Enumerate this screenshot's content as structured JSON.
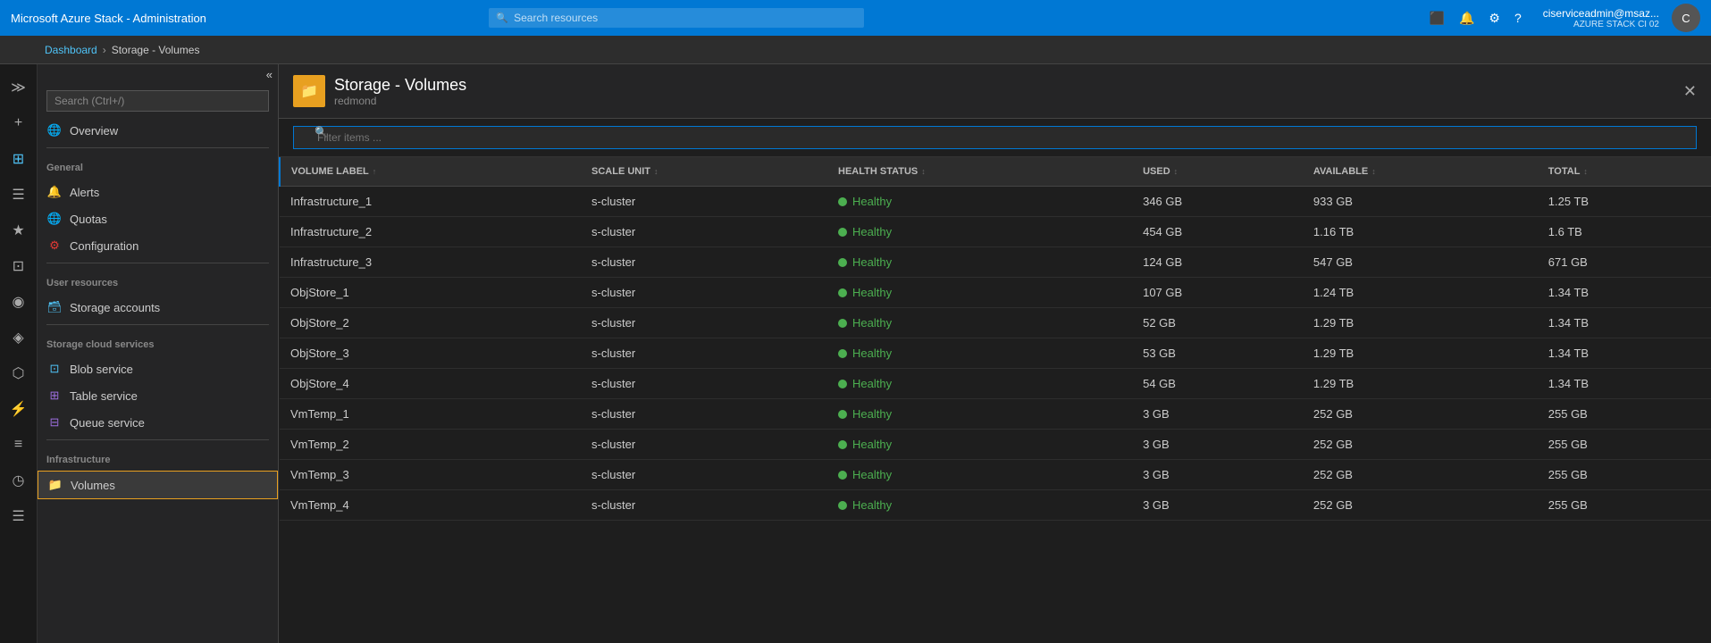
{
  "app": {
    "title": "Microsoft Azure Stack - Administration"
  },
  "topbar": {
    "search_placeholder": "Search resources",
    "user_name": "ciserviceadmin@msaz...",
    "user_sub": "AZURE STACK CI 02"
  },
  "breadcrumb": {
    "root": "Dashboard",
    "current": "Storage - Volumes"
  },
  "sidebar": {
    "search_placeholder": "Search (Ctrl+/)",
    "overview_label": "Overview",
    "general_label": "General",
    "alerts_label": "Alerts",
    "quotas_label": "Quotas",
    "configuration_label": "Configuration",
    "user_resources_label": "User resources",
    "storage_accounts_label": "Storage accounts",
    "storage_cloud_label": "Storage cloud services",
    "blob_service_label": "Blob service",
    "table_service_label": "Table service",
    "queue_service_label": "Queue service",
    "infrastructure_label": "Infrastructure",
    "volumes_label": "Volumes"
  },
  "content": {
    "title": "Storage - Volumes",
    "subtitle": "redmond",
    "filter_placeholder": "Filter items ..."
  },
  "table": {
    "columns": [
      {
        "key": "volume_label",
        "label": "VOLUME LABEL"
      },
      {
        "key": "scale_unit",
        "label": "SCALE UNIT"
      },
      {
        "key": "health_status",
        "label": "HEALTH STATUS"
      },
      {
        "key": "used",
        "label": "USED"
      },
      {
        "key": "available",
        "label": "AVAILABLE"
      },
      {
        "key": "total",
        "label": "TOTAL"
      }
    ],
    "rows": [
      {
        "volume_label": "Infrastructure_1",
        "scale_unit": "s-cluster",
        "health_status": "Healthy",
        "used": "346 GB",
        "available": "933 GB",
        "total": "1.25 TB"
      },
      {
        "volume_label": "Infrastructure_2",
        "scale_unit": "s-cluster",
        "health_status": "Healthy",
        "used": "454 GB",
        "available": "1.16 TB",
        "total": "1.6 TB"
      },
      {
        "volume_label": "Infrastructure_3",
        "scale_unit": "s-cluster",
        "health_status": "Healthy",
        "used": "124 GB",
        "available": "547 GB",
        "total": "671 GB"
      },
      {
        "volume_label": "ObjStore_1",
        "scale_unit": "s-cluster",
        "health_status": "Healthy",
        "used": "107 GB",
        "available": "1.24 TB",
        "total": "1.34 TB"
      },
      {
        "volume_label": "ObjStore_2",
        "scale_unit": "s-cluster",
        "health_status": "Healthy",
        "used": "52 GB",
        "available": "1.29 TB",
        "total": "1.34 TB"
      },
      {
        "volume_label": "ObjStore_3",
        "scale_unit": "s-cluster",
        "health_status": "Healthy",
        "used": "53 GB",
        "available": "1.29 TB",
        "total": "1.34 TB"
      },
      {
        "volume_label": "ObjStore_4",
        "scale_unit": "s-cluster",
        "health_status": "Healthy",
        "used": "54 GB",
        "available": "1.29 TB",
        "total": "1.34 TB"
      },
      {
        "volume_label": "VmTemp_1",
        "scale_unit": "s-cluster",
        "health_status": "Healthy",
        "used": "3 GB",
        "available": "252 GB",
        "total": "255 GB"
      },
      {
        "volume_label": "VmTemp_2",
        "scale_unit": "s-cluster",
        "health_status": "Healthy",
        "used": "3 GB",
        "available": "252 GB",
        "total": "255 GB"
      },
      {
        "volume_label": "VmTemp_3",
        "scale_unit": "s-cluster",
        "health_status": "Healthy",
        "used": "3 GB",
        "available": "252 GB",
        "total": "255 GB"
      },
      {
        "volume_label": "VmTemp_4",
        "scale_unit": "s-cluster",
        "health_status": "Healthy",
        "used": "3 GB",
        "available": "252 GB",
        "total": "255 GB"
      }
    ]
  },
  "nav_icons": [
    "≫",
    "+",
    "⊞",
    "☰",
    "★",
    "⊞",
    "◉",
    "◈",
    "⬡",
    "⚡",
    "≡",
    "◷",
    "☰"
  ],
  "colors": {
    "accent": "#0078d4",
    "healthy": "#4caf50",
    "folder": "#e8a020"
  }
}
